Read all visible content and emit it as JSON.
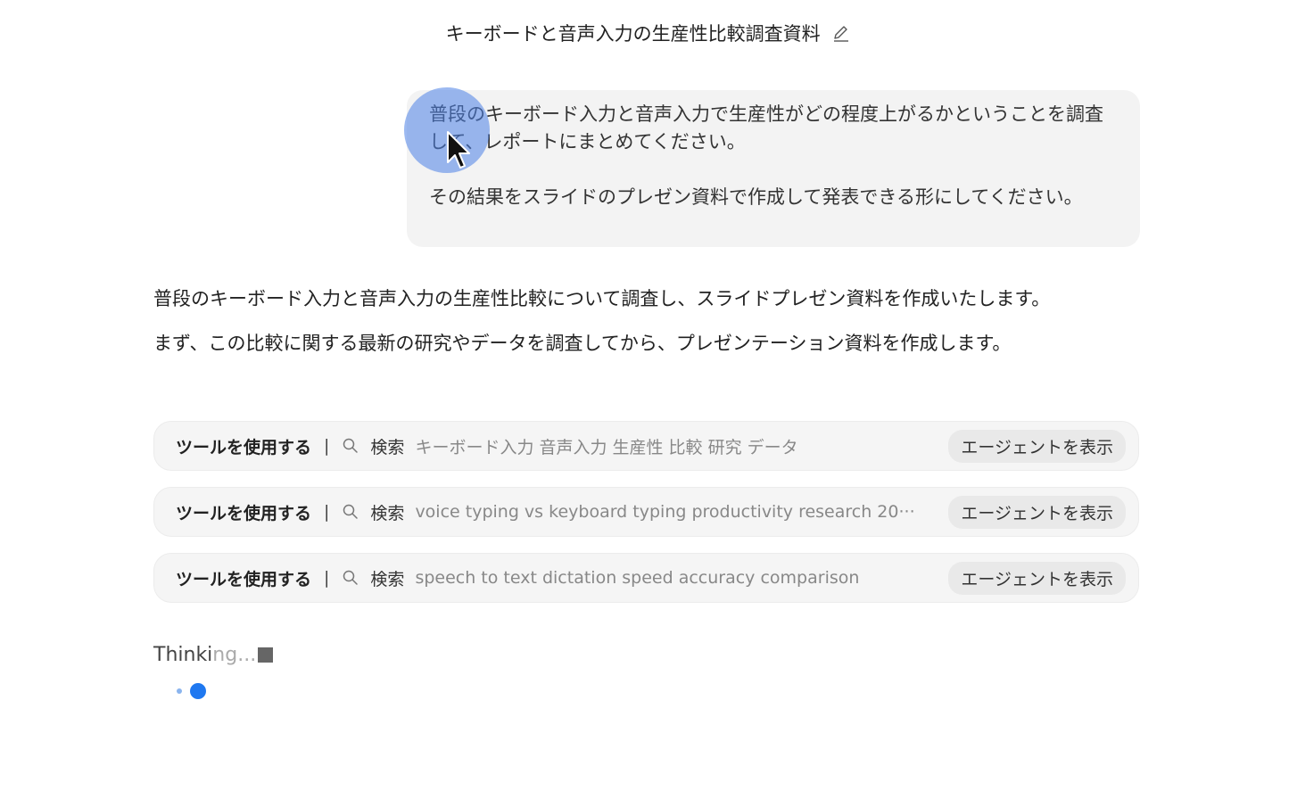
{
  "header": {
    "title": "キーボードと音声入力の生産性比較調査資料",
    "edit_icon": "pencil-icon"
  },
  "user_message": {
    "paragraph1": "普段のキーボード入力と音声入力で生産性がどの程度上がるかということを調査して、レポートにまとめてください。",
    "paragraph2": "その結果をスライドのプレゼン資料で作成して発表できる形にしてください。"
  },
  "assistant_message": {
    "paragraph1": "普段のキーボード入力と音声入力の生産性比較について調査し、スライドプレゼン資料を作成いたします。",
    "paragraph2": "まず、この比較に関する最新の研究やデータを調査してから、プレゼンテーション資料を作成します。"
  },
  "tool_calls": [
    {
      "label": "ツールを使用する",
      "separator": "|",
      "icon": "search-icon",
      "kind": "検索",
      "query": "キーボード入力 音声入力 生産性 比較 研究 データ",
      "button": "エージェントを表示"
    },
    {
      "label": "ツールを使用する",
      "separator": "|",
      "icon": "search-icon",
      "kind": "検索",
      "query": "voice typing vs keyboard typing productivity research 20···",
      "button": "エージェントを表示"
    },
    {
      "label": "ツールを使用する",
      "separator": "|",
      "icon": "search-icon",
      "kind": "検索",
      "query": "speech to text dictation speed accuracy comparison",
      "button": "エージェントを表示"
    }
  ],
  "status": {
    "thinking_main": "Thinki",
    "thinking_fade": "ng...",
    "accent_color": "#1f78f0"
  }
}
